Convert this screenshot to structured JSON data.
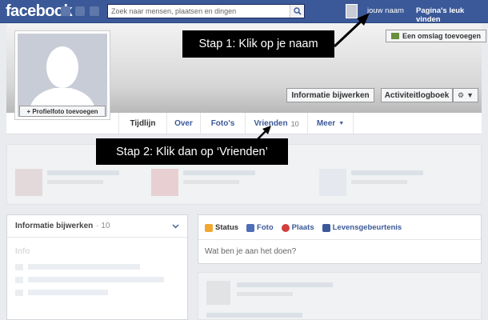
{
  "topbar": {
    "logo": "facebook",
    "search_placeholder": "Zoek naar mensen, plaatsen en dingen",
    "user_name": "jouw naam",
    "pages_link": "Pagina's leuk vinden"
  },
  "cover": {
    "add_cover_label": "Een omslag toevoegen",
    "update_info_label": "Informatie bijwerken",
    "activity_log_label": "Activiteitlogboek"
  },
  "profile": {
    "add_photo_label": "+ Profielfoto toevoegen"
  },
  "tabs": [
    {
      "label": "Tijdlijn",
      "count": ""
    },
    {
      "label": "Over",
      "count": ""
    },
    {
      "label": "Foto's",
      "count": ""
    },
    {
      "label": "Vrienden",
      "count": "10"
    },
    {
      "label": "Meer",
      "count": ""
    }
  ],
  "left_panel": {
    "title": "Informatie bijwerken",
    "count": "· 10",
    "sub_title": "Info"
  },
  "composer": {
    "tabs": [
      {
        "label": "Status",
        "icon": "pencil-icon",
        "color": "#f0a830"
      },
      {
        "label": "Foto",
        "icon": "photo-icon",
        "color": "#4e6eb5"
      },
      {
        "label": "Plaats",
        "icon": "place-icon",
        "color": "#d33f3f"
      },
      {
        "label": "Levensgebeurtenis",
        "icon": "flag-icon",
        "color": "#3b5998"
      }
    ],
    "placeholder": "Wat ben je aan het doen?"
  },
  "annotations": {
    "step1": "Stap 1: Klik op je naam",
    "step2": "Stap 2: Klik dan op ‘Vrienden’"
  },
  "colors": {
    "brand": "#3b5998",
    "callout_bg": "#000000"
  }
}
